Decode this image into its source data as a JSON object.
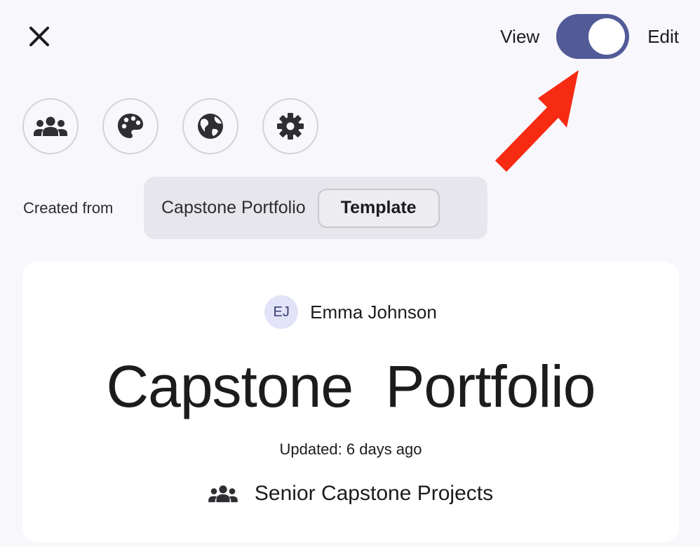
{
  "header": {
    "close_icon": "close-icon",
    "toggle": {
      "left_label": "View",
      "right_label": "Edit",
      "state": "edit",
      "accent": "#525b98"
    }
  },
  "icon_toolbar": [
    {
      "icon": "people-icon",
      "name": "members"
    },
    {
      "icon": "palette-icon",
      "name": "theme"
    },
    {
      "icon": "globe-icon",
      "name": "visibility"
    },
    {
      "icon": "gear-icon",
      "name": "settings"
    }
  ],
  "source": {
    "label": "Created from",
    "name": "Capstone Portfolio",
    "chip": "Template"
  },
  "card": {
    "author_initials": "EJ",
    "author_name": "Emma Johnson",
    "title": "Capstone  Portfolio",
    "updated": "Updated: 6 days ago",
    "group_icon": "people-icon",
    "group_name": "Senior Capstone Projects"
  },
  "annotation": {
    "arrow_color": "#f62b12"
  }
}
